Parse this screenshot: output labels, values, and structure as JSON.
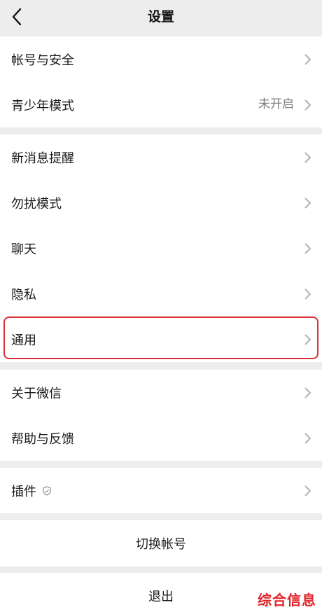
{
  "header": {
    "title": "设置",
    "back_icon": "chevron-left-icon"
  },
  "groups": [
    {
      "items": [
        {
          "label": "帐号与安全",
          "value": ""
        },
        {
          "label": "青少年模式",
          "value": "未开启"
        }
      ]
    },
    {
      "items": [
        {
          "label": "新消息提醒",
          "value": ""
        },
        {
          "label": "勿扰模式",
          "value": ""
        },
        {
          "label": "聊天",
          "value": ""
        },
        {
          "label": "隐私",
          "value": ""
        },
        {
          "label": "通用",
          "value": "",
          "highlighted": true
        }
      ]
    },
    {
      "items": [
        {
          "label": "关于微信",
          "value": ""
        },
        {
          "label": "帮助与反馈",
          "value": ""
        }
      ]
    },
    {
      "items": [
        {
          "label": "插件",
          "value": "",
          "icon": "shield-icon"
        }
      ]
    }
  ],
  "actions": {
    "switch_account": "切换帐号",
    "logout": "退出"
  },
  "watermark": "综合信息",
  "colors": {
    "background": "#ededed",
    "highlight_border": "#d9303a",
    "watermark": "#e0242a"
  }
}
